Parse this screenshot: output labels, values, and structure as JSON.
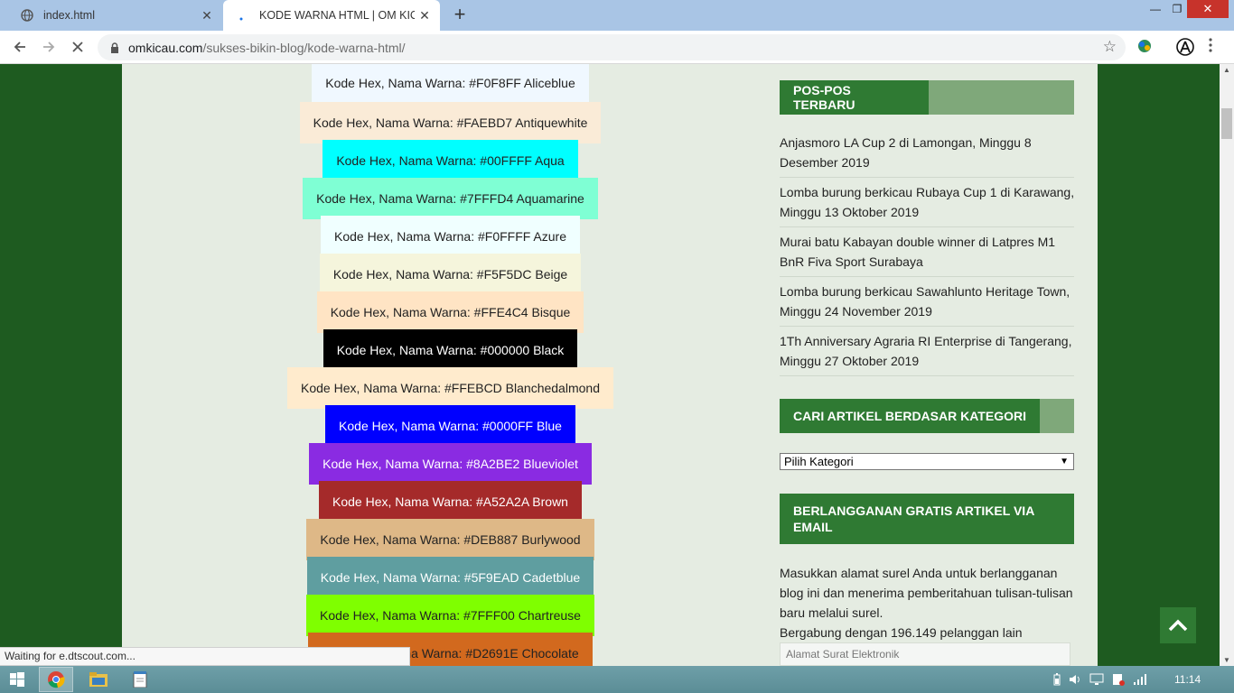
{
  "browser": {
    "tabs": [
      {
        "title": "index.html",
        "active": false
      },
      {
        "title": "KODE WARNA HTML | OM KICAU",
        "active": true
      }
    ],
    "url_domain": "omkicau.com",
    "url_path": "/sukses-bikin-blog/kode-warna-html/",
    "status_text": "Waiting for e.dtscout.com..."
  },
  "swatches": [
    {
      "label": "Kode Hex, Nama Warna: #F0F8FF Aliceblue",
      "bg": "#F0F8FF",
      "fg": "#222222"
    },
    {
      "label": "Kode Hex, Nama Warna: #FAEBD7 Antiquewhite",
      "bg": "#FAEBD7",
      "fg": "#222222"
    },
    {
      "label": "Kode Hex, Nama Warna: #00FFFF Aqua",
      "bg": "#00FFFF",
      "fg": "#222222"
    },
    {
      "label": "Kode Hex, Nama Warna: #7FFFD4 Aquamarine",
      "bg": "#7FFFD4",
      "fg": "#222222"
    },
    {
      "label": "Kode Hex, Nama Warna: #F0FFFF Azure",
      "bg": "#F0FFFF",
      "fg": "#222222"
    },
    {
      "label": "Kode Hex, Nama Warna: #F5F5DC Beige",
      "bg": "#F5F5DC",
      "fg": "#222222"
    },
    {
      "label": "Kode Hex, Nama Warna: #FFE4C4 Bisque",
      "bg": "#FFE4C4",
      "fg": "#222222"
    },
    {
      "label": "Kode Hex, Nama Warna: #000000 Black",
      "bg": "#000000",
      "fg": "#FFFFFF"
    },
    {
      "label": "Kode Hex, Nama Warna: #FFEBCD Blanchedalmond",
      "bg": "#FFEBCD",
      "fg": "#222222"
    },
    {
      "label": "Kode Hex, Nama Warna: #0000FF Blue",
      "bg": "#0000FF",
      "fg": "#FFFFFF"
    },
    {
      "label": "Kode Hex, Nama Warna: #8A2BE2 Blueviolet",
      "bg": "#8A2BE2",
      "fg": "#FFFFFF"
    },
    {
      "label": "Kode Hex, Nama Warna: #A52A2A Brown",
      "bg": "#A52A2A",
      "fg": "#FFFFFF"
    },
    {
      "label": "Kode Hex, Nama Warna: #DEB887 Burlywood",
      "bg": "#DEB887",
      "fg": "#222222"
    },
    {
      "label": "Kode Hex, Nama Warna: #5F9EAD Cadetblue",
      "bg": "#5F9EA0",
      "fg": "#FFFFFF"
    },
    {
      "label": "Kode Hex, Nama Warna: #7FFF00 Chartreuse",
      "bg": "#7FFF00",
      "fg": "#222222"
    },
    {
      "label": "Kode Hex, Nama Warna: #D2691E Chocolate",
      "bg": "#D2691E",
      "fg": "#222222"
    }
  ],
  "sidebar": {
    "recent_title": "POS-POS TERBARU",
    "recent_posts": [
      "Anjasmoro LA Cup 2 di Lamongan, Minggu 8 Desember 2019",
      "Lomba burung berkicau Rubaya Cup 1 di Karawang, Minggu 13 Oktober 2019",
      "Murai batu Kabayan double winner di Latpres M1 BnR Fiva Sport Surabaya",
      "Lomba burung berkicau Sawahlunto Heritage Town, Minggu 24 November 2019",
      "1Th Anniversary Agraria RI Enterprise di Tangerang, Minggu 27 Oktober 2019"
    ],
    "category_title": "CARI ARTIKEL BERDASAR KATEGORI",
    "category_select": "Pilih Kategori",
    "subscribe_title": "BERLANGGANAN GRATIS ARTIKEL VIA EMAIL",
    "subscribe_desc": "Masukkan alamat surel Anda untuk berlangganan blog ini dan menerima pemberitahuan tulisan-tulisan baru melalui surel.",
    "subscribe_count": "Bergabung dengan 196.149 pelanggan lain",
    "email_placeholder": "Alamat Surat Elektronik"
  },
  "taskbar": {
    "clock": "11:14"
  },
  "colors": {
    "page_bg": "#1e5b20",
    "content_bg": "#e5ece2",
    "widget_green": "#2f7a33",
    "widget_light": "#7fa87a"
  }
}
